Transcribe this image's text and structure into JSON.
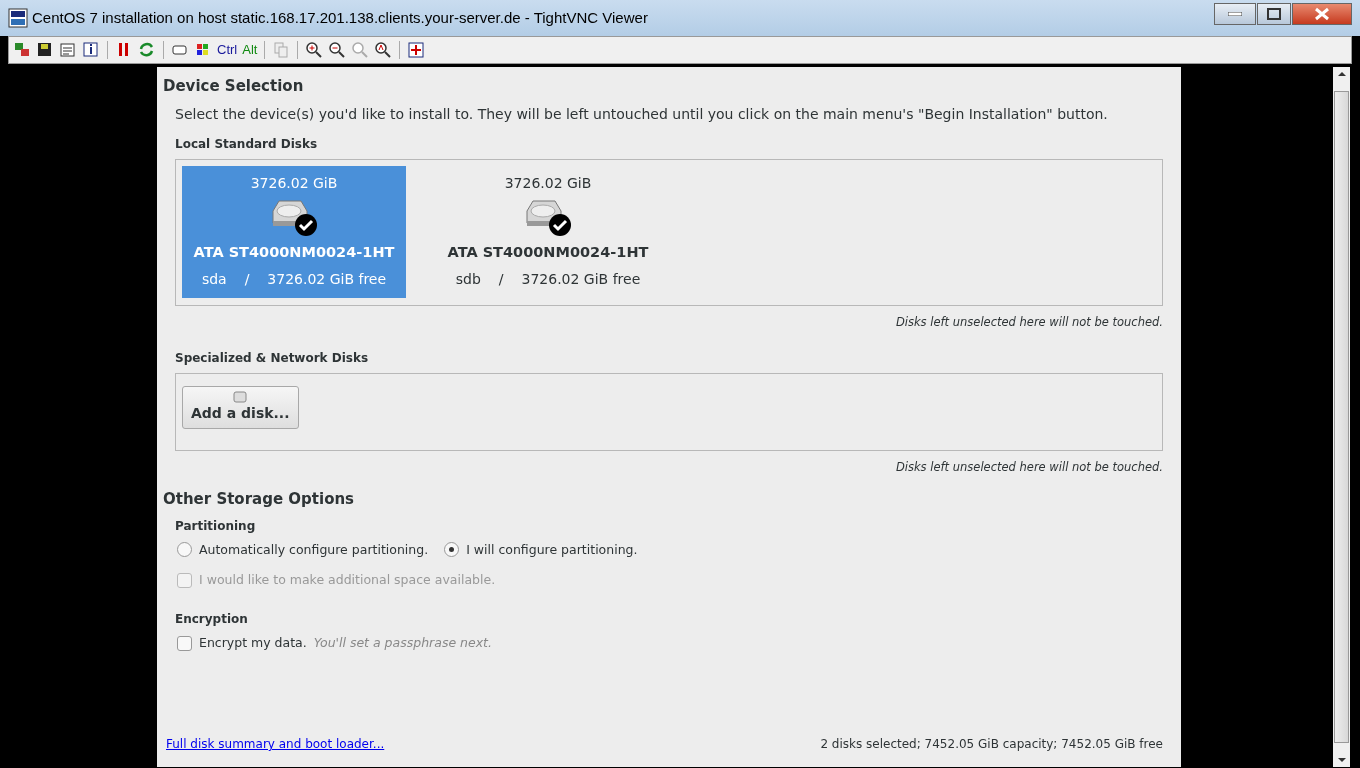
{
  "window": {
    "title": "CentOS 7 installation on host static.168.17.201.138.clients.your-server.de - TightVNC Viewer"
  },
  "toolbar": {
    "keys": [
      {
        "label": "Ctrl",
        "color": "#1a1a9c"
      },
      {
        "label": "Alt",
        "color": "#118a11"
      }
    ]
  },
  "device_selection": {
    "title": "Device Selection",
    "intro": "Select the device(s) you'd like to install to.  They will be left untouched until you click on the main menu's \"Begin Installation\" button.",
    "local_title": "Local Standard Disks",
    "disks": [
      {
        "size": "3726.02 GiB",
        "model": "ATA ST4000NM0024-1HT",
        "name": "sda",
        "sep": "/",
        "free": "3726.02 GiB free",
        "selected": true,
        "checked": true
      },
      {
        "size": "3726.02 GiB",
        "model": "ATA ST4000NM0024-1HT",
        "name": "sdb",
        "sep": "/",
        "free": "3726.02 GiB free",
        "selected": false,
        "checked": true
      }
    ],
    "local_note": "Disks left unselected here will not be touched.",
    "special_title": "Specialized & Network Disks",
    "add_button": "Add a disk...",
    "special_note": "Disks left unselected here will not be touched."
  },
  "other": {
    "title": "Other Storage Options",
    "partitioning_title": "Partitioning",
    "radios": [
      {
        "label": "Automatically configure partitioning.",
        "selected": false
      },
      {
        "label": "I will configure partitioning.",
        "selected": true
      }
    ],
    "space": {
      "label": "I would like to make additional space available.",
      "checked": false,
      "disabled": true
    },
    "encryption_title": "Encryption",
    "encrypt": {
      "label": "Encrypt my data.",
      "hint": "You'll set a passphrase next.",
      "checked": false,
      "disabled": false
    }
  },
  "footer": {
    "link": "Full disk summary and boot loader...",
    "summary": "2 disks selected; 7452.05 GiB capacity; 7452.05 GiB free"
  }
}
